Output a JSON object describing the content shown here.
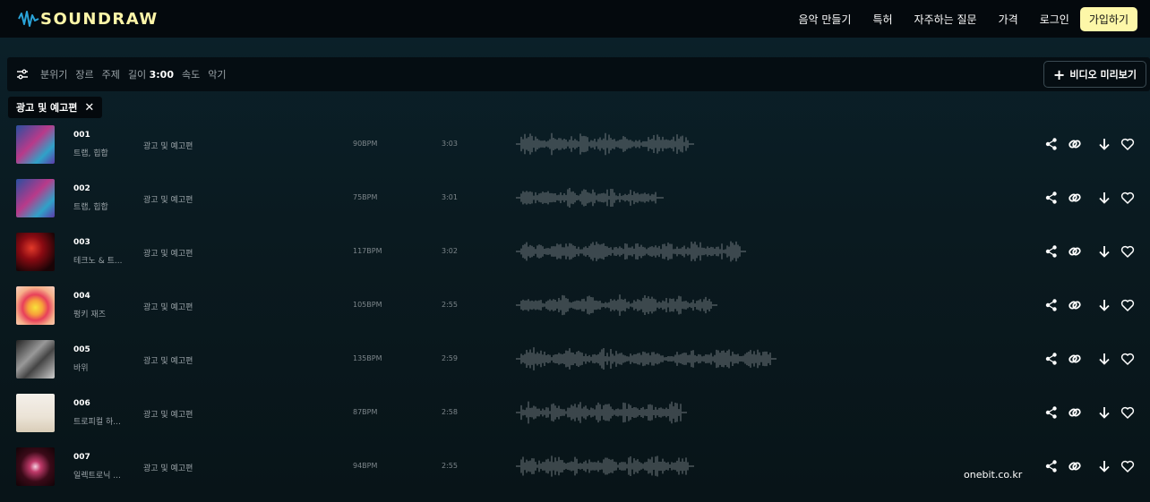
{
  "nav": {
    "logo_text": "SOUNDRAW",
    "links": [
      "음악 만들기",
      "특허",
      "자주하는 질문",
      "가격",
      "로그인"
    ],
    "signup_label": "가입하기"
  },
  "filters": {
    "items": [
      "분위기",
      "장르",
      "주제"
    ],
    "length_label": "길이",
    "length_value": "3:00",
    "tempo_label": "속도",
    "instrument_label": "악기",
    "video_preview_label": "비디오 미리보기"
  },
  "active_chip": {
    "label": "광고 및 예고편"
  },
  "tracks": [
    {
      "number": "001",
      "genre": "트랩, 힙합",
      "category": "광고 및 예고편",
      "bpm": "90BPM",
      "length": "3:03"
    },
    {
      "number": "002",
      "genre": "트랩, 힙합",
      "category": "광고 및 예고편",
      "bpm": "75BPM",
      "length": "3:01"
    },
    {
      "number": "003",
      "genre": "테크노 & 트...",
      "category": "광고 및 예고편",
      "bpm": "117BPM",
      "length": "3:02"
    },
    {
      "number": "004",
      "genre": "펑키 재즈",
      "category": "광고 및 예고편",
      "bpm": "105BPM",
      "length": "2:55"
    },
    {
      "number": "005",
      "genre": "바위",
      "category": "광고 및 예고편",
      "bpm": "135BPM",
      "length": "2:59"
    },
    {
      "number": "006",
      "genre": "트로피컬 하...",
      "category": "광고 및 예고편",
      "bpm": "87BPM",
      "length": "2:58"
    },
    {
      "number": "007",
      "genre": "일렉트로닉 ...",
      "category": "광고 및 예고편",
      "bpm": "94BPM",
      "length": "2:55"
    }
  ],
  "track_actions": [
    "share-icon",
    "link-icon",
    "download-icon",
    "heart-icon"
  ],
  "watermark": "onebit.co.kr",
  "colors": {
    "accent": "#fdf7a8",
    "background": "#0a1d24",
    "nav_bg": "#04090d",
    "waveform": "#6e777c"
  }
}
